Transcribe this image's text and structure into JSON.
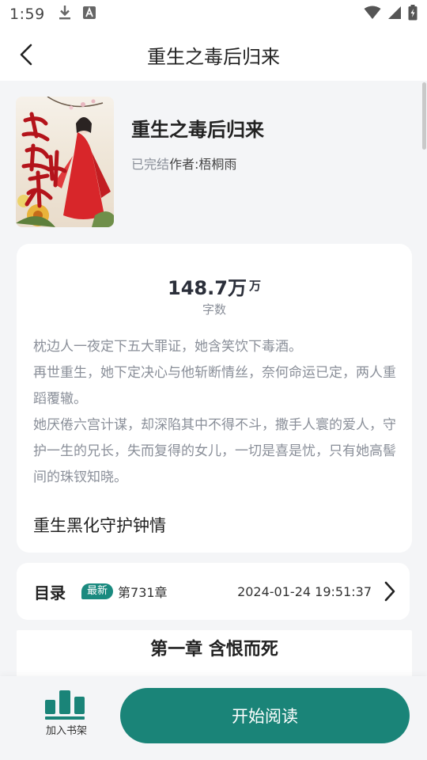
{
  "status_bar": {
    "time": "1:59"
  },
  "nav": {
    "title": "重生之毒后归来"
  },
  "book": {
    "title": "重生之毒后归来",
    "status": "已完结",
    "author_prefix": "作者: ",
    "author": "梧桐雨",
    "cover_text": "毒后归来"
  },
  "info": {
    "wordcount_value": "148.7万",
    "wordcount_unit": "万",
    "wordcount_label": "字数",
    "synopsis": [
      "枕边人一夜定下五大罪证，她含笑饮下毒酒。",
      "再世重生，她下定决心与他斩断情丝，奈何命运已定，两人重蹈覆辙。",
      "她厌倦六宫计谋，却深陷其中不得不斗，撒手人寰的爱人，守护一生的兄长，失而复得的女儿，一切是喜是忧，只有她高髻间的珠钗知晓。"
    ],
    "tags": "重生黑化守护钟情"
  },
  "toc": {
    "label": "目录",
    "badge": "最新",
    "chapter": "第731章",
    "time": "2024-01-24 19:51:37"
  },
  "preview": {
    "chapter_title": "第一章 含恨而死"
  },
  "bottom": {
    "shelf_label": "加入书架",
    "read_label": "开始阅读"
  },
  "colors": {
    "accent": "#1a8478",
    "badge": "#1a8a7f",
    "muted_text": "#8a8f99"
  }
}
